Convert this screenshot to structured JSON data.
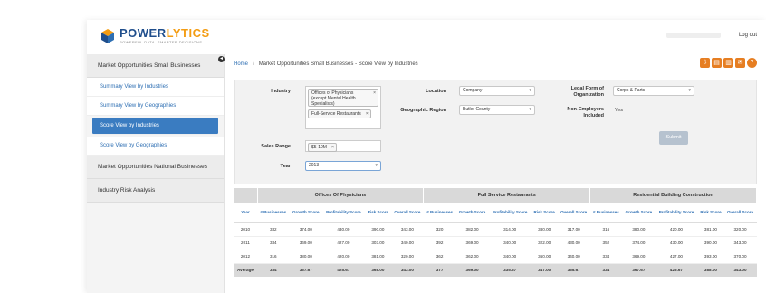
{
  "header": {
    "logo_name_a": "POWER",
    "logo_name_b": "LYTICS",
    "logo_tagline": "POWERFUL DATA. SMARTER DECISIONS",
    "logout": "Log out",
    "brand_colors": {
      "primary": "#1f4e8c",
      "accent": "#f39c12",
      "action": "#e67e22",
      "link": "#2e6fb3",
      "active": "#3a7cc1"
    }
  },
  "sidebar": {
    "section1": "Market Opportunities Small Businesses",
    "items": [
      {
        "label": "Summary View by Industries"
      },
      {
        "label": "Summary View by Geographies"
      },
      {
        "label": "Score View by Industries"
      },
      {
        "label": "Score View by Geographies"
      }
    ],
    "section2": "Market Opportunities National Businesses",
    "section3": "Industry Risk Analysis"
  },
  "breadcrumb": {
    "home": "Home",
    "current": "Market Opportunities Small Businesses - Score View by Industries"
  },
  "toolbar": {
    "icons": [
      "cloud-download-icon",
      "file-export-icon",
      "file-pdf-icon",
      "mail-icon",
      "help-icon"
    ]
  },
  "filters": {
    "industry_label": "Industry",
    "industry_tags": [
      "Offices of Physicians (except Mental Health Specialists)",
      "Full-Service Restaurants"
    ],
    "sales_range_label": "Sales Range",
    "sales_range_tag": "$5-10M",
    "year_label": "Year",
    "year_value": "2013",
    "location_label": "Location",
    "location_value": "Company",
    "geo_region_label": "Geographic Region",
    "geo_region_value": "Butler County",
    "legal_form_label": "Legal Form of Organization",
    "legal_form_value": "Corps & Parts",
    "non_employers_label": "Non-Employers Included",
    "non_employers_value": "Yes",
    "submit": "Submit"
  },
  "table": {
    "groups": [
      "Offices Of Physicians",
      "Full Service Restaurants",
      "Residential Building Construction"
    ],
    "year_header": "Year",
    "columns": [
      "# Businesses",
      "Growth Score",
      "Profitability Score",
      "Risk Score",
      "Overall Score"
    ],
    "rows": [
      {
        "year": "2010",
        "values": [
          "332",
          "374.00",
          "430.00",
          "390.00",
          "343.00",
          "320",
          "382.00",
          "314.00",
          "380.00",
          "317.00",
          "316",
          "380.00",
          "420.00",
          "381.00",
          "320.00"
        ]
      },
      {
        "year": "2011",
        "values": [
          "334",
          "369.00",
          "427.00",
          "303.00",
          "340.00",
          "392",
          "369.00",
          "340.00",
          "322.00",
          "430.00",
          "352",
          "374.00",
          "430.00",
          "390.00",
          "343.00"
        ]
      },
      {
        "year": "2012",
        "values": [
          "316",
          "380.00",
          "420.00",
          "381.00",
          "320.00",
          "362",
          "362.00",
          "340.00",
          "360.00",
          "340.00",
          "334",
          "369.00",
          "427.00",
          "393.00",
          "370.00"
        ]
      }
    ],
    "average": {
      "year": "Average",
      "values": [
        "334",
        "367.67",
        "425.67",
        "368.00",
        "343.00",
        "377",
        "369.00",
        "335.67",
        "347.00",
        "365.67",
        "334",
        "367.67",
        "425.67",
        "388.00",
        "343.00"
      ]
    }
  }
}
